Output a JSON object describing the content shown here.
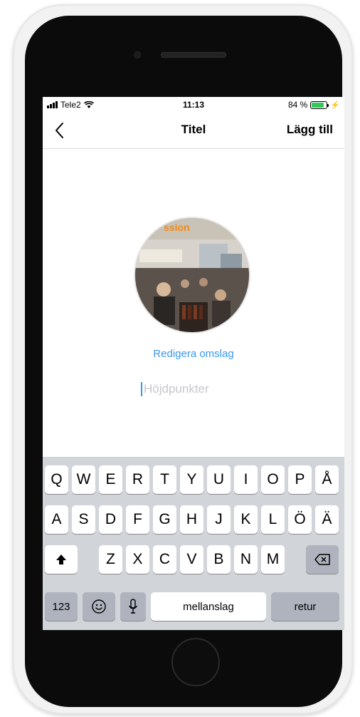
{
  "status_bar": {
    "carrier": "Tele2",
    "time": "11:13",
    "battery_percent": "84 %",
    "battery_level": 0.84
  },
  "nav": {
    "back_icon": "chevron-left-icon",
    "title": "Titel",
    "action": "Lägg till"
  },
  "content": {
    "edit_cover": "Redigera omslag",
    "title_placeholder": "Höjdpunkter"
  },
  "keyboard": {
    "row1": [
      "Q",
      "W",
      "E",
      "R",
      "T",
      "Y",
      "U",
      "I",
      "O",
      "P",
      "Å"
    ],
    "row2": [
      "A",
      "S",
      "D",
      "F",
      "G",
      "H",
      "J",
      "K",
      "L",
      "Ö",
      "Ä"
    ],
    "row3": [
      "Z",
      "X",
      "C",
      "V",
      "B",
      "N",
      "M"
    ],
    "numbers_key": "123",
    "space_key": "mellanslag",
    "return_key": "retur"
  },
  "colors": {
    "accent": "#3897f0",
    "battery": "#34c759",
    "keyboard_bg": "#d1d4d9"
  }
}
